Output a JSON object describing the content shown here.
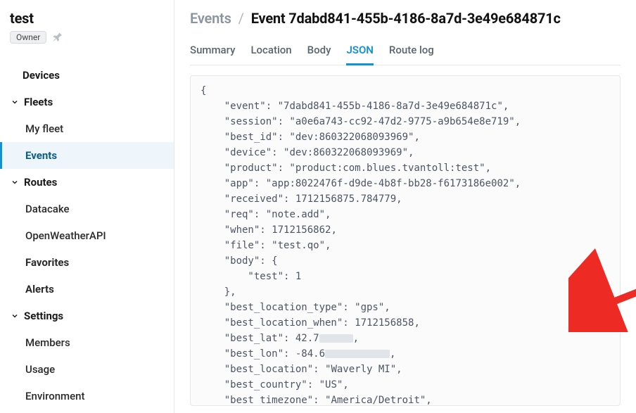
{
  "sidebar": {
    "title": "test",
    "owner_badge": "Owner",
    "nav": {
      "devices": "Devices",
      "fleets": "Fleets",
      "my_fleet": "My fleet",
      "events": "Events",
      "routes": "Routes",
      "datacake": "Datacake",
      "openweather": "OpenWeatherAPI",
      "favorites": "Favorites",
      "alerts": "Alerts",
      "settings": "Settings",
      "members": "Members",
      "usage": "Usage",
      "environment": "Environment"
    }
  },
  "breadcrumb": {
    "root": "Events",
    "current": "Event 7dabd841-455b-4186-8a7d-3e49e684871c"
  },
  "tabs": {
    "summary": "Summary",
    "location": "Location",
    "body": "Body",
    "json": "JSON",
    "route_log": "Route log"
  },
  "json": {
    "event": "7dabd841-455b-4186-8a7d-3e49e684871c",
    "session": "a0e6a743-cc92-47d2-9775-a9b654e8e719",
    "best_id": "dev:860322068093969",
    "device": "dev:860322068093969",
    "product": "product:com.blues.tvantoll:test",
    "app": "app:8022476f-d9de-4b8f-bb28-f6173186e002",
    "received": 1712156875.784779,
    "req": "note.add",
    "when": 1712156862,
    "file": "test.qo",
    "body_key": "body",
    "body_test_key": "test",
    "body_test_val": 1,
    "best_location_type": "gps",
    "best_location_when": 1712156858,
    "best_lat_prefix": "42.7",
    "best_lon_prefix": "-84.6",
    "best_location": "Waverly MI",
    "best_country": "US",
    "best_timezone": "America/Detroit"
  }
}
